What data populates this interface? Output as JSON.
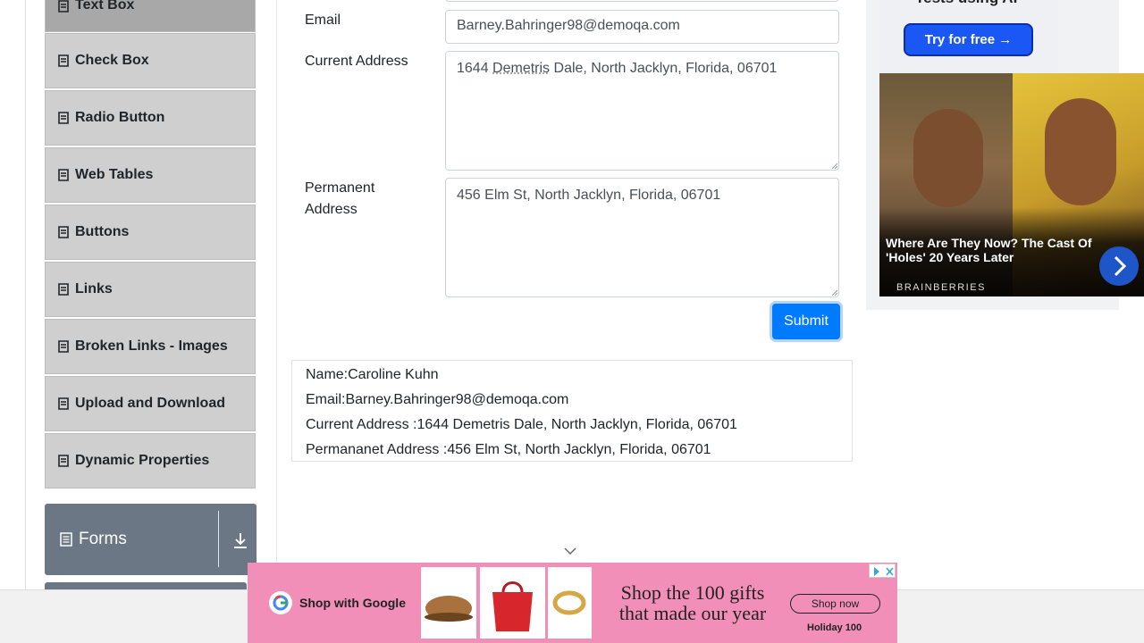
{
  "sidebar": {
    "items": [
      {
        "label": "Text Box"
      },
      {
        "label": "Check Box"
      },
      {
        "label": "Radio Button"
      },
      {
        "label": "Web Tables"
      },
      {
        "label": "Buttons"
      },
      {
        "label": "Links"
      },
      {
        "label": "Broken Links - Images"
      },
      {
        "label": "Upload and Download"
      },
      {
        "label": "Dynamic Properties"
      }
    ],
    "group": {
      "label": "Forms",
      "icon": "document-icon"
    }
  },
  "form": {
    "email_label": "Email",
    "email_value": "Barney.Bahringer98@demoqa.com",
    "current_address_label": "Current Address",
    "current_address_prefix": "1644 ",
    "current_address_misspelled": "Demetris",
    "current_address_suffix": " Dale, North Jacklyn, Florida, 06701",
    "permanent_address_label_line1": "Permanent",
    "permanent_address_label_line2": "Address",
    "permanent_address_value": "456 Elm St, North Jacklyn, Florida, 06701",
    "submit_label": "Submit"
  },
  "output": {
    "name": "Name:Caroline Kuhn",
    "email": "Email:Barney.Bahringer98@demoqa.com",
    "current_address": "Current Address :1644 Demetris Dale, North Jacklyn, Florida, 06701",
    "permanent_address": "Permananet Address :456 Elm St, North Jacklyn, Florida, 06701"
  },
  "ad_right": {
    "tagline": "Tests using AI",
    "button_label": "Try for free →",
    "headline": "Where Are They Now? The Cast Of 'Holes' 20 Years Later",
    "brand": "BRAINBERRIES"
  },
  "ad_bottom": {
    "shop_label": "Shop with Google",
    "copy": "Shop the 100 gifts that made our year",
    "cta": "Shop now",
    "footer": "Holiday 100"
  },
  "colors": {
    "primary": "#007bff",
    "sidebar_item": "#cfcfcf",
    "sidebar_group": "#6b7785",
    "ad_pink": "#f28fb9"
  }
}
